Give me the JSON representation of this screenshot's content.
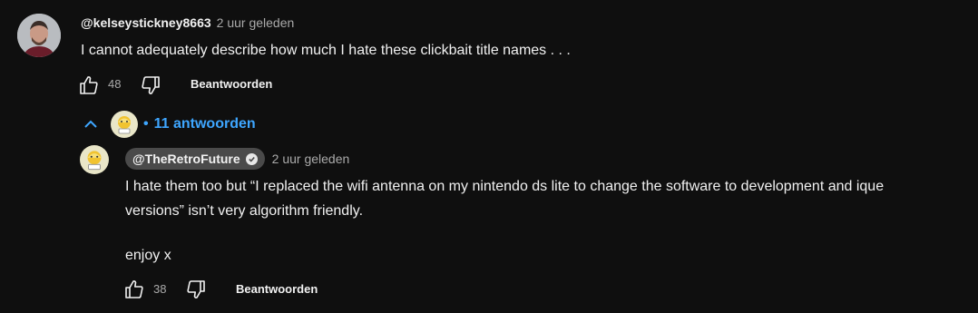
{
  "comment": {
    "author": "@kelseystickney8663",
    "time": "2 uur geleden",
    "text": "I cannot adequately describe how much I hate these clickbait title names . . .",
    "likes": "48",
    "reply_label": "Beantwoorden",
    "avatar_icon": "person-avatar-icon"
  },
  "replies_toggle": {
    "bullet": "•",
    "label": "11 antwoorden",
    "icon": "chevron-up-icon",
    "color": "#3ea6ff"
  },
  "reply": {
    "author": "@TheRetroFuture",
    "time": "2 uur geleden",
    "line1": "I hate them too but “I replaced the wifi antenna on my nintendo ds lite to change the software to development and ique",
    "line2": "versions” isn’t very algorithm friendly.",
    "line3": "enjoy x",
    "likes": "38",
    "reply_label": "Beantwoorden",
    "verified_icon": "verified-check-icon"
  }
}
